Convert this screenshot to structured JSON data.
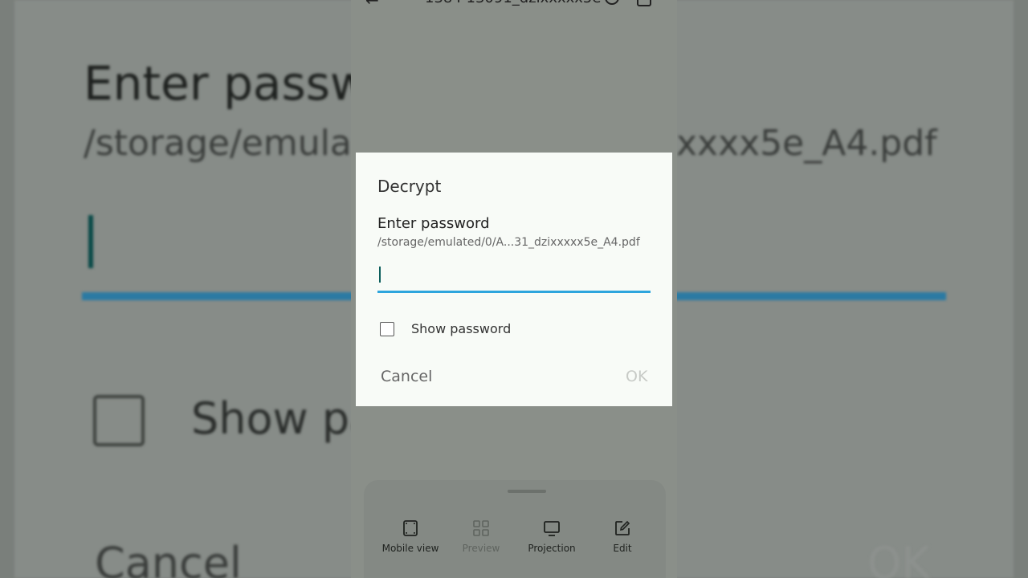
{
  "background": {
    "title": "Enter passw",
    "path_start": "/storage/emula",
    "path_end": "xxxx5e_A4.pdf",
    "show_label": "Show pa",
    "cancel_label": "Cancel",
    "ok_label": "OK"
  },
  "topbar": {
    "filename": "1384 13091_dzixxxxx5e"
  },
  "dialog": {
    "title": "Decrypt",
    "prompt": "Enter password",
    "path": "/storage/emulated/0/A...31_dzixxxxx5e_A4.pdf",
    "password_value": "",
    "show_password_label": "Show password",
    "show_password_checked": false,
    "cancel_label": "Cancel",
    "ok_label": "OK",
    "accent_color": "#2ea5dd"
  },
  "bottom_actions": [
    {
      "label": "Mobile view",
      "icon": "mobile-view-icon",
      "enabled": true
    },
    {
      "label": "Preview",
      "icon": "grid-icon",
      "enabled": false
    },
    {
      "label": "Projection",
      "icon": "monitor-icon",
      "enabled": true
    },
    {
      "label": "Edit",
      "icon": "edit-icon",
      "enabled": true
    }
  ]
}
